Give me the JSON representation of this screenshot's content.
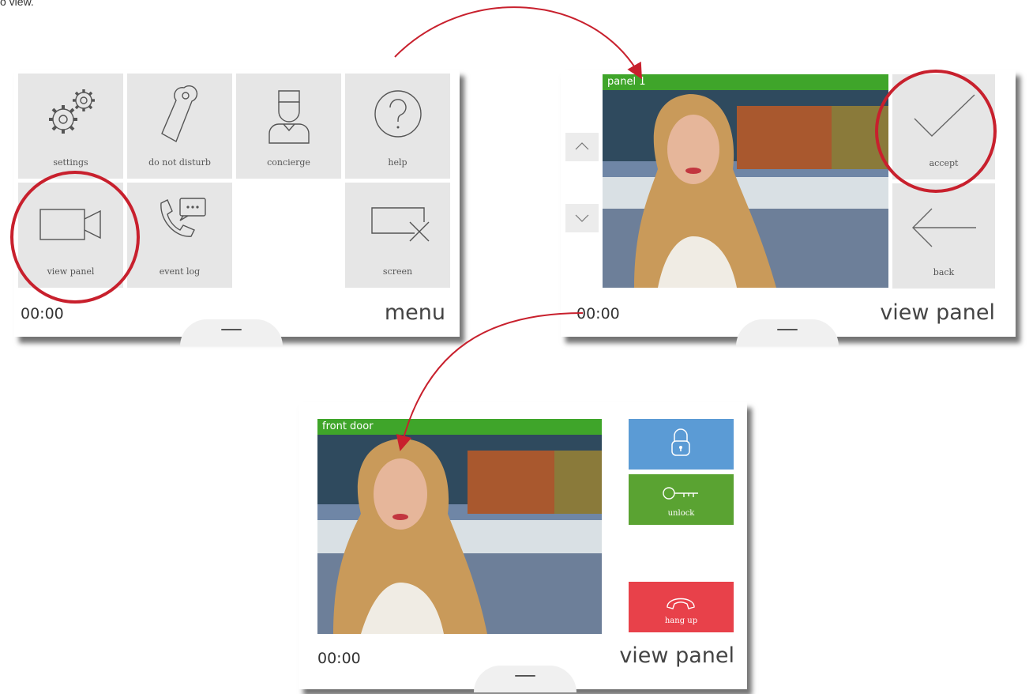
{
  "caption": "o view.",
  "colors": {
    "accent_red": "#c8202d",
    "green_bar": "#3fa52a",
    "tile_gray": "#e6e6e6",
    "unlock_blue": "#5b9bd5",
    "unlock_green": "#5aa332",
    "hangup_red": "#e8414a"
  },
  "menu_screen": {
    "tiles": [
      {
        "label": "settings",
        "icon": "gears-icon"
      },
      {
        "label": "do not disturb",
        "icon": "door-hanger-icon"
      },
      {
        "label": "concierge",
        "icon": "concierge-icon"
      },
      {
        "label": "help",
        "icon": "question-icon"
      },
      {
        "label": "view panel",
        "icon": "camera-icon"
      },
      {
        "label": "event log",
        "icon": "phone-chat-icon"
      },
      {
        "label": "screen",
        "icon": "screen-off-icon"
      }
    ],
    "time": "00:00",
    "title": "menu"
  },
  "call_screen": {
    "video_label": "panel 1",
    "accept_label": "accept",
    "back_label": "back",
    "time": "00:00",
    "title": "view panel"
  },
  "door_screen": {
    "video_label": "front door",
    "lock_icon": "lock-icon",
    "unlock_label": "unlock",
    "hangup_label": "hang up",
    "time": "00:00",
    "title": "view panel"
  }
}
